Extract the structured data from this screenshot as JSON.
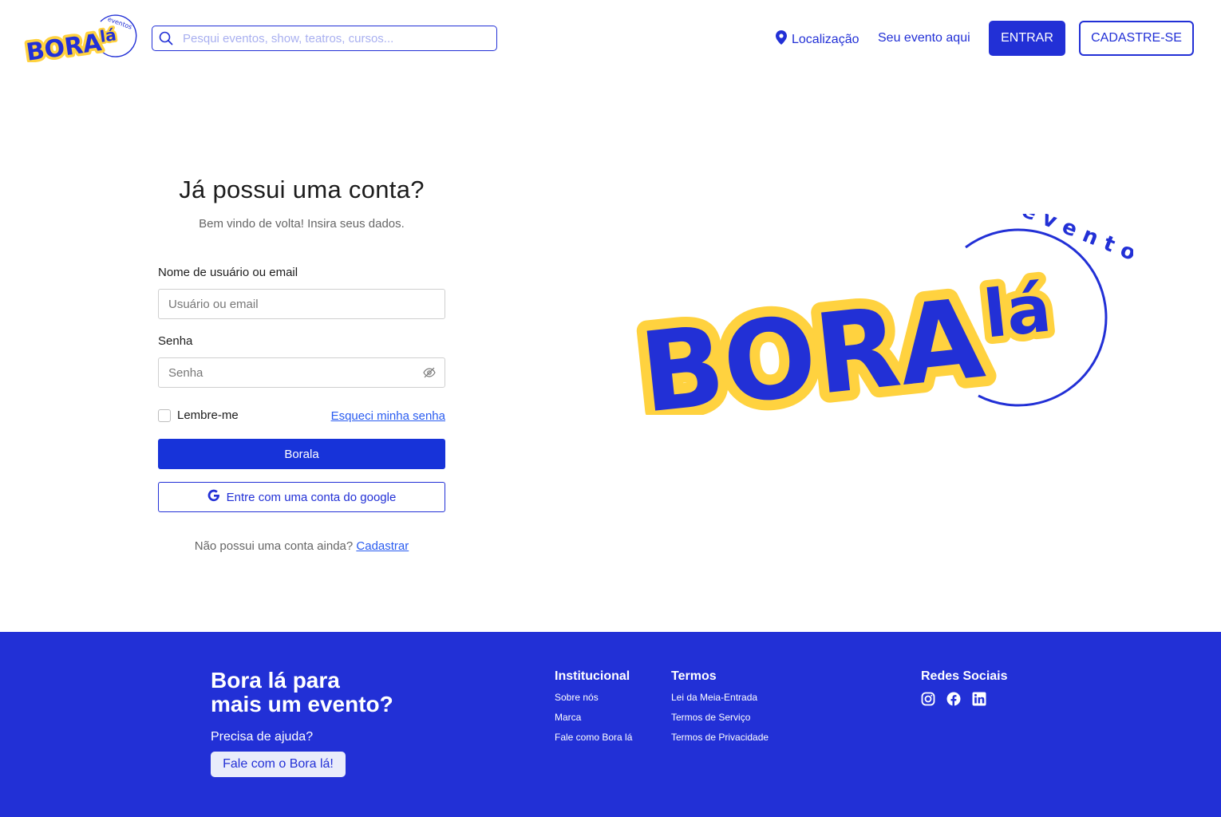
{
  "header": {
    "search_placeholder": "Pesqui eventos, show, teatros, cursos...",
    "location_label": "Localização",
    "event_link": "Seu evento aqui",
    "login_button": "ENTRAR",
    "signup_button": "CADASTRE-SE"
  },
  "logo": {
    "main": "BORA",
    "accent": "lá",
    "tag": "eventos"
  },
  "login": {
    "title": "Já possui uma conta?",
    "subtitle": "Bem vindo de volta! Insira seus dados.",
    "user_label": "Nome de usuário ou email",
    "user_placeholder": "Usuário ou email",
    "password_label": "Senha",
    "password_placeholder": "Senha",
    "remember_label": "Lembre-me",
    "forgot_link": "Esqueci minha senha",
    "submit_button": "Borala",
    "google_button": "Entre com uma conta do google",
    "no_account_text": "Não possui uma conta ainda?",
    "register_link": "Cadastrar"
  },
  "footer": {
    "title_line1": "Bora lá para",
    "title_line2": "mais um evento?",
    "help_text": "Precisa de ajuda?",
    "contact_button": "Fale com o Bora lá!",
    "institutional": {
      "heading": "Institucional",
      "links": [
        "Sobre nós",
        "Marca",
        "Fale como Bora lá"
      ]
    },
    "terms": {
      "heading": "Termos",
      "links": [
        "Lei da Meia-Entrada",
        "Termos de Serviço",
        "Termos de Privacidade"
      ]
    },
    "social": {
      "heading": "Redes Sociais",
      "icons": [
        "instagram-icon",
        "facebook-icon",
        "linkedin-icon"
      ]
    }
  },
  "colors": {
    "primary": "#2230d6",
    "accent_yellow": "#ffd23f",
    "link": "#2a5cf0"
  }
}
